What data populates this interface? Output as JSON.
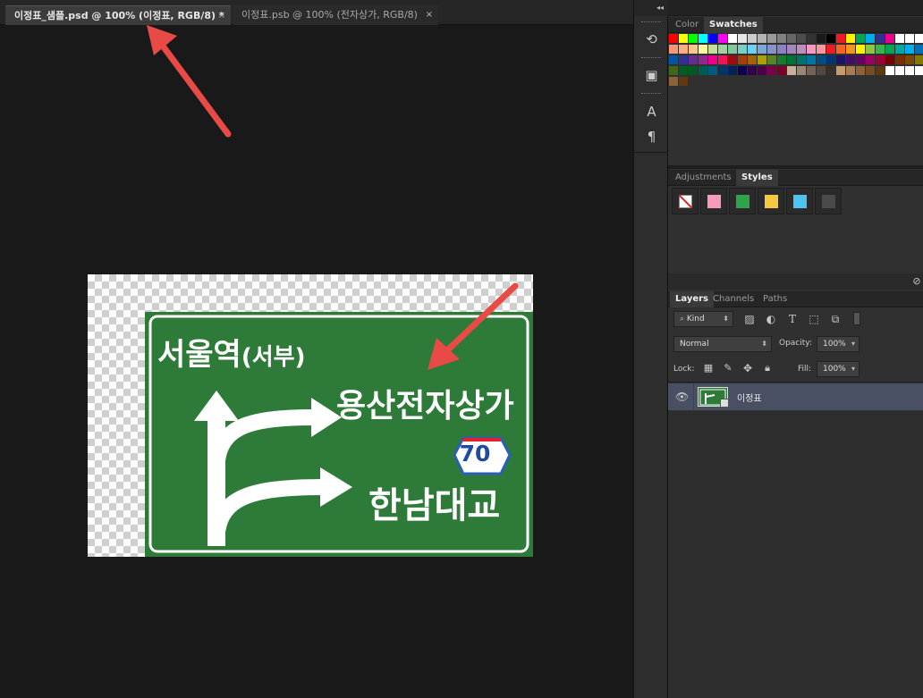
{
  "tabs": [
    {
      "label": "이정표_샘플.psd @ 100% (이정표, RGB/8) *",
      "close": "×"
    },
    {
      "label": "이정표.psb @ 100% (전자상가, RGB/8)",
      "close": "×"
    }
  ],
  "sign": {
    "line1": "서울역",
    "line1_sub": "(서부)",
    "line2": "용산전자상가",
    "route_number": "70",
    "line3": "한남대교"
  },
  "collapse_glyph": "◂◂",
  "panels": {
    "swatches_tabs": [
      "Color",
      "Swatches"
    ],
    "styles_tabs": [
      "Adjustments",
      "Styles"
    ],
    "layers_tabs": [
      "Layers",
      "Channels",
      "Paths"
    ],
    "filter_kind": "Kind",
    "blend_mode": "Normal",
    "opacity_label": "Opacity:",
    "opacity_value": "100%",
    "lock_label": "Lock:",
    "fill_label": "Fill:",
    "fill_value": "100%",
    "layer_name": "이정표"
  },
  "style_colors": [
    "#f79ac0",
    "#2fa34a",
    "#f5c842",
    "#4fc3f0",
    "#4a4a4a"
  ],
  "swatch_rows": [
    [
      "#ff0000",
      "#ffff00",
      "#00ff00",
      "#00ffff",
      "#0000ff",
      "#ff00ff",
      "#ffffff",
      "#e6e6e6",
      "#cccccc",
      "#b3b3b3",
      "#999999",
      "#808080",
      "#666666",
      "#4d4d4d",
      "#333333",
      "#1a1a1a",
      "#000000",
      "#ed1c24",
      "#fff200",
      "#00a651",
      "#00aeef",
      "#2e3192",
      "#ec008c",
      "#ffffff",
      "#ffffff",
      "#ffffff"
    ],
    [
      "#f7977a",
      "#f9ad81",
      "#fdc68a",
      "#fff79a",
      "#c4df9b",
      "#a2d39c",
      "#82ca9d",
      "#7bcdc8",
      "#6ecff6",
      "#7ea7d8",
      "#8493ca",
      "#8882be",
      "#a187be",
      "#bc8dbf",
      "#f49ac2",
      "#f6989d",
      "#ed1c24",
      "#f26522",
      "#f7941d",
      "#fff200",
      "#8dc63f",
      "#39b54a",
      "#00a651",
      "#00a99d",
      "#00aeef",
      "#0072bc"
    ],
    [
      "#0054a6",
      "#2e3192",
      "#662d91",
      "#92278f",
      "#ec008c",
      "#ed145b",
      "#9e0b0f",
      "#a0410d",
      "#a36209",
      "#aba000",
      "#598527",
      "#1a7b30",
      "#007236",
      "#00746b",
      "#0076a3",
      "#004b80",
      "#003471",
      "#1b1464",
      "#440e62",
      "#630460",
      "#9e005d",
      "#9e0039",
      "#790000",
      "#7b2e00",
      "#7d4900",
      "#827b00"
    ],
    [
      "#406618",
      "#005e20",
      "#005826",
      "#005952",
      "#005b7f",
      "#003663",
      "#002157",
      "#0d004c",
      "#32004b",
      "#4b0049",
      "#7b0046",
      "#7a0026",
      "#c7b299",
      "#998675",
      "#736357",
      "#534741",
      "#37302d",
      "#c69c6d",
      "#a67c52",
      "#8c6239",
      "#754c24",
      "#603913",
      "#ffffff",
      "#ffffff",
      "#ffffff",
      "#ffffff"
    ],
    [
      "#8c6239",
      "#603913"
    ]
  ]
}
